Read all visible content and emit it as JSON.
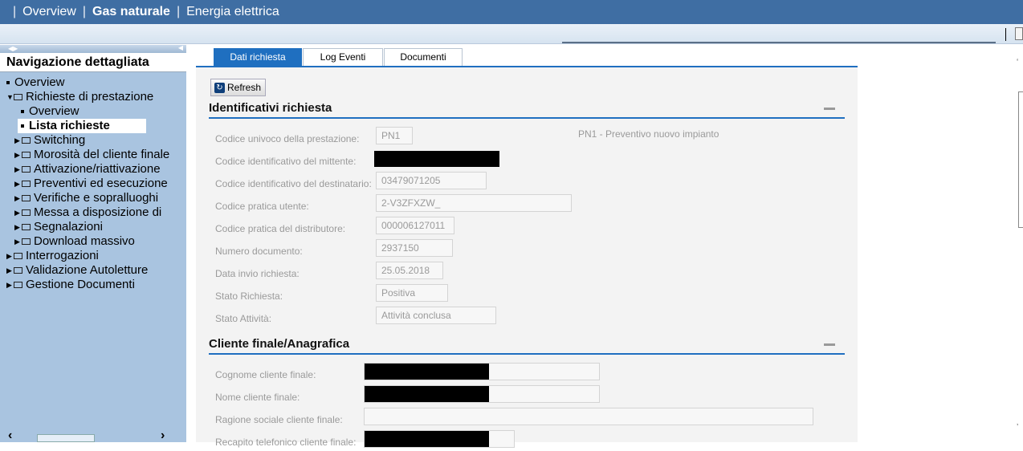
{
  "topnav": {
    "items": [
      "Overview",
      "Gas naturale",
      "Energia elettrica"
    ],
    "separator": "|"
  },
  "sidebar": {
    "title": "Navigazione dettagliata",
    "tree": [
      {
        "label": "Overview"
      },
      {
        "label": "Richieste di prestazione"
      },
      {
        "label": "Overview"
      },
      {
        "label": "Lista richieste"
      },
      {
        "label": "Switching"
      },
      {
        "label": "Morosità del cliente finale"
      },
      {
        "label": "Attivazione/riattivazione"
      },
      {
        "label": "Preventivi ed esecuzione"
      },
      {
        "label": "Verifiche e sopralluoghi"
      },
      {
        "label": "Messa a disposizione di"
      },
      {
        "label": "Segnalazioni"
      },
      {
        "label": "Download massivo"
      },
      {
        "label": "Interrogazioni"
      },
      {
        "label": "Validazione Autoletture"
      },
      {
        "label": "Gestione Documenti"
      }
    ]
  },
  "tabs": [
    "Dati richiesta",
    "Log Eventi",
    "Documenti"
  ],
  "toolbar": {
    "refresh_label": "Refresh"
  },
  "section1": {
    "title": "Identificativi richiesta",
    "fields": [
      {
        "label": "Codice univoco della prestazione:",
        "value": "PN1",
        "desc": "PN1 - Preventivo nuovo impianto"
      },
      {
        "label": "Codice identificativo del mittente:",
        "value": ""
      },
      {
        "label": "Codice identificativo del destinatario:",
        "value": "03479071205"
      },
      {
        "label": "Codice pratica utente:",
        "value": "2-V3ZFXZW_"
      },
      {
        "label": "Codice pratica del distributore:",
        "value": "000006127011"
      },
      {
        "label": "Numero documento:",
        "value": "2937150"
      },
      {
        "label": "Data invio richiesta:",
        "value": "25.05.2018"
      },
      {
        "label": "Stato Richiesta:",
        "value": "Positiva"
      },
      {
        "label": "Stato Attività:",
        "value": "Attività conclusa"
      }
    ]
  },
  "section2": {
    "title": "Cliente finale/Anagrafica",
    "fields": [
      {
        "label": "Cognome cliente finale:",
        "value": ""
      },
      {
        "label": "Nome cliente finale:",
        "value": ""
      },
      {
        "label": "Ragione sociale cliente finale:",
        "value": ""
      },
      {
        "label": "Recapito telefonico cliente finale:",
        "value": ""
      }
    ]
  }
}
